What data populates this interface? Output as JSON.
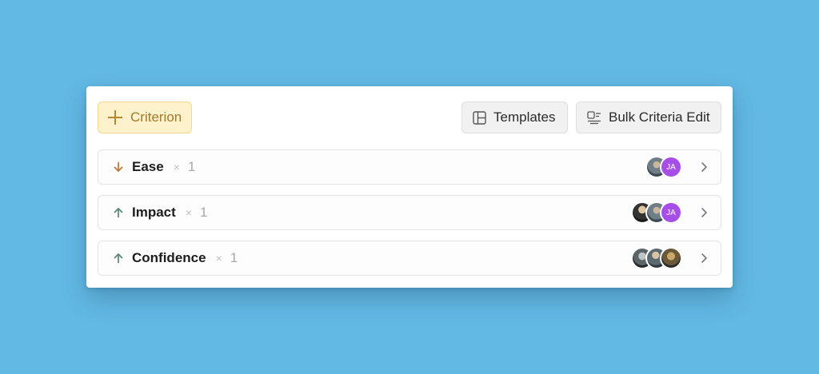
{
  "toolbar": {
    "criterion_label": "Criterion",
    "templates_label": "Templates",
    "bulk_edit_label": "Bulk Criteria Edit"
  },
  "criteria": [
    {
      "name": "Ease",
      "direction": "down",
      "direction_icon": "arrow-down-icon",
      "direction_color": "#c0763a",
      "times": "×",
      "weight": "1",
      "avatars": [
        {
          "type": "photo",
          "initials": ""
        },
        {
          "type": "initials",
          "initials": "JA"
        }
      ]
    },
    {
      "name": "Impact",
      "direction": "up",
      "direction_icon": "arrow-up-icon",
      "direction_color": "#5c8a7a",
      "times": "×",
      "weight": "1",
      "avatars": [
        {
          "type": "photo",
          "initials": ""
        },
        {
          "type": "photo",
          "initials": ""
        },
        {
          "type": "initials",
          "initials": "JA"
        }
      ]
    },
    {
      "name": "Confidence",
      "direction": "up",
      "direction_icon": "arrow-up-icon",
      "direction_color": "#5c8a7a",
      "times": "×",
      "weight": "1",
      "avatars": [
        {
          "type": "photo",
          "initials": ""
        },
        {
          "type": "photo",
          "initials": ""
        },
        {
          "type": "photo",
          "initials": ""
        }
      ]
    }
  ],
  "colors": {
    "background": "#62b9e4",
    "criterion_button_bg": "#fdf2cc",
    "criterion_button_text": "#a37a2a",
    "initials_avatar": "#a84ee8"
  }
}
